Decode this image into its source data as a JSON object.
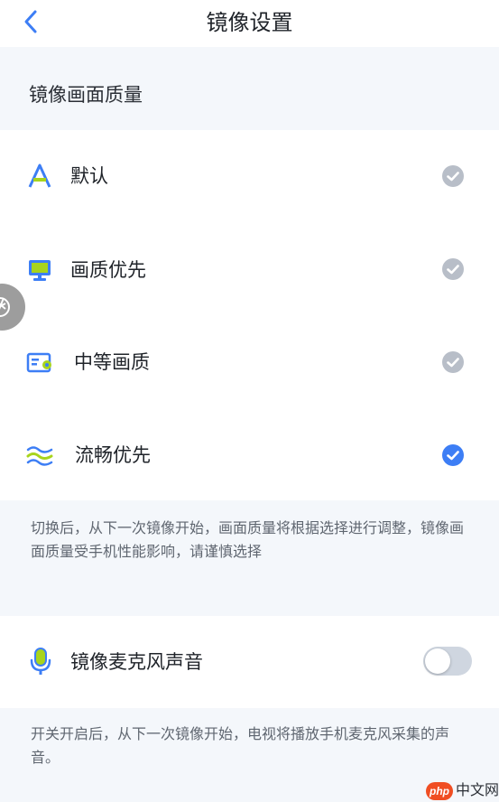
{
  "header": {
    "title": "镜像设置",
    "back_icon": "chevron-left-icon"
  },
  "quality_section": {
    "title": "镜像画面质量",
    "options": [
      {
        "label": "默认",
        "icon": "letter-a-icon",
        "selected": false
      },
      {
        "label": "画质优先",
        "icon": "monitor-icon",
        "selected": false
      },
      {
        "label": "中等画质",
        "icon": "certificate-icon",
        "selected": false
      },
      {
        "label": "流畅优先",
        "icon": "waves-icon",
        "selected": true
      }
    ],
    "note": "切换后，从下一次镜像开始，画面质量将根据选择进行调整，镜像画面质量受手机性能影响，请谨慎选择"
  },
  "mic_section": {
    "label": "镜像麦克风声音",
    "icon": "microphone-icon",
    "enabled": false,
    "note": "开关开启后，从下一次镜像开始，电视将播放手机麦克风采集的声音。"
  },
  "floating_button": {
    "icon": "aperture-icon"
  },
  "watermark": {
    "badge": "php",
    "text": "中文网"
  },
  "colors": {
    "accent": "#3d7ef5",
    "check_inactive": "#b8bec8",
    "page_bg": "#f4f7fb",
    "toggle_off": "#cfd6e0"
  }
}
